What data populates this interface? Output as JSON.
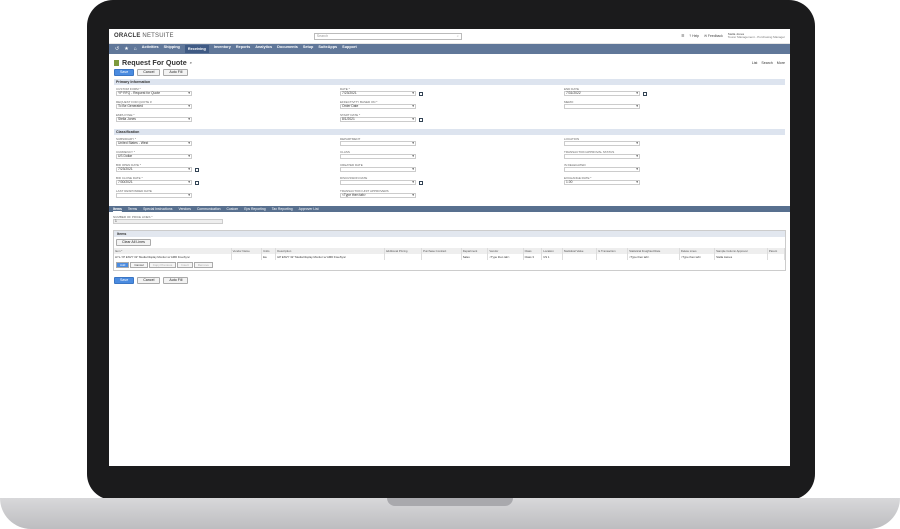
{
  "app": {
    "logo_brand": "ORACLE",
    "logo_product": "NETSUITE",
    "search_placeholder": "Search",
    "help": "Help",
    "feedback": "Feedback",
    "user_name": "Stella Jones",
    "user_role": "Tourer Management - Purchasing Manager"
  },
  "nav": {
    "items": [
      "Activities",
      "Shipping",
      "Receiving",
      "Inventory",
      "Reports",
      "Analytics",
      "Documents",
      "Setup",
      "SuiteApps",
      "Support"
    ],
    "active": "Receiving"
  },
  "page": {
    "title": "Request For Quote",
    "actions": [
      "List",
      "Search",
      "More"
    ],
    "buttons": {
      "save": "Save",
      "cancel": "Cancel",
      "autofill": "Auto Fill"
    }
  },
  "primary": {
    "heading": "Primary Information",
    "col1": [
      {
        "label": "Custom Form *",
        "value": "YP RFQ - Request for Quote"
      },
      {
        "label": "Request for Quote #",
        "value": "To Be Generated"
      },
      {
        "label": "Employee *",
        "value": "Stella Jones"
      }
    ],
    "col2": [
      {
        "label": "Date *",
        "value": "7/23/2021"
      },
      {
        "label": "Effectivity Based On *",
        "value": "Order Date"
      },
      {
        "label": "Start Date *",
        "value": "8/1/2021"
      }
    ],
    "col3": [
      {
        "label": "End Date",
        "value": "7/31/2022"
      },
      {
        "label": "Memo",
        "value": ""
      }
    ]
  },
  "classification": {
    "heading": "Classification",
    "col1": [
      {
        "label": "Subsidiary *",
        "value": "United States - West"
      },
      {
        "label": "Currency *",
        "value": "US Dollar"
      },
      {
        "label": "Bid Open Date *",
        "value": "7/23/2021"
      },
      {
        "label": "Bid Close Date *",
        "value": "7/30/2021"
      },
      {
        "label": "Last Responded Date",
        "value": ""
      }
    ],
    "col2": [
      {
        "label": "Department",
        "value": ""
      },
      {
        "label": "Class",
        "value": ""
      },
      {
        "label": "Created Date",
        "value": ""
      },
      {
        "label": "Discussion Date",
        "value": ""
      },
      {
        "label": "Transaction Unit Approvers",
        "value": "<Type then tab>"
      }
    ],
    "col3": [
      {
        "label": "Location",
        "value": ""
      },
      {
        "label": "Transaction Approval Status",
        "value": ""
      },
      {
        "label": "Is Delegated",
        "value": ""
      },
      {
        "label": "Exchange Rate *",
        "value": "1.00"
      }
    ]
  },
  "tabs": [
    "Items",
    "Terms",
    "Special Instructions",
    "Vendors",
    "Communication",
    "Custom",
    "Eps Reporting",
    "Tax Reporting",
    "Approver List"
  ],
  "items_tab": {
    "num_label": "Number of Price Lines *",
    "num_value": "1",
    "section": "Items",
    "clear_btn": "Clear All Lines",
    "columns": [
      "Item *",
      "Vendor Name",
      "Units",
      "Description",
      "Additional Pricing",
      "Purchase Contract",
      "Department",
      "Vendor",
      "Class",
      "Location",
      "Statistical Value",
      "Is Transaction",
      "Statistical Freighted Rate",
      "Delete Lines",
      "Sample Column Approver",
      "Parent"
    ],
    "row": [
      "HYL-YP ENVY 32\" Media Display Monitor w/ AMD FreeSync",
      "",
      "Ea",
      "HP ENVY 32\" Media Display Monitor w/ AMD FreeSync",
      "",
      "",
      "Sales",
      "<Type then tab>",
      "Class 3",
      "US 1",
      "",
      "",
      "<Type then tab>",
      "<Type then tab>",
      "Stella James",
      ""
    ],
    "row_buttons": [
      "Add",
      "Cancel",
      "Copy Previous",
      "Insert",
      "Remove"
    ]
  }
}
